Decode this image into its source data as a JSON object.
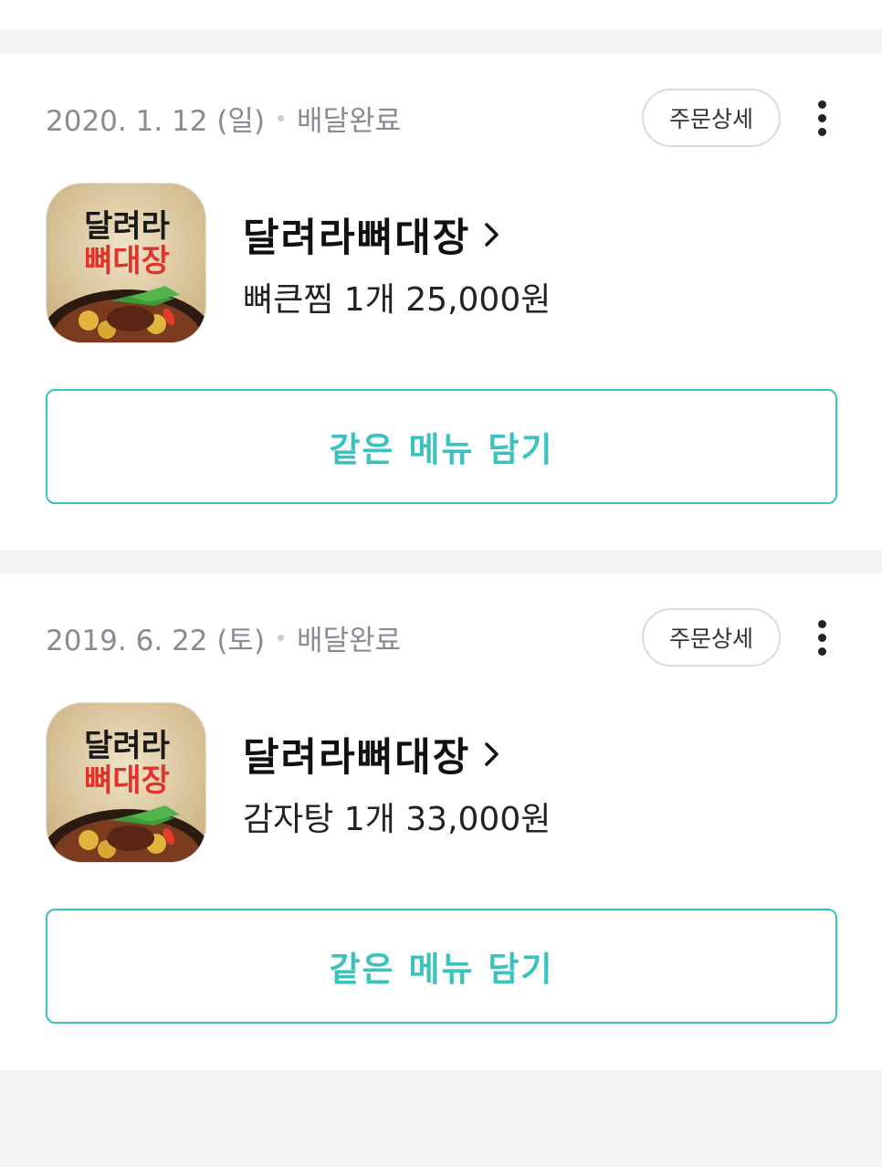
{
  "colors": {
    "accent": "#3bc1be",
    "page_background": "#f2f3f5",
    "card_background": "#ffffff",
    "meta_text": "#888c92"
  },
  "orders": [
    {
      "date": "2020. 1. 12 (일)",
      "status": "배달완료",
      "detail_label": "주문상세",
      "more_icon": "more-vertical-icon",
      "store_name": "달려라뼈대장",
      "logo_line1": "달려라",
      "logo_line2": "뼈대장",
      "menu_summary": "뼈큰찜 1개 25,000원",
      "reorder_label": "같은 메뉴 담기"
    },
    {
      "date": "2019. 6. 22 (토)",
      "status": "배달완료",
      "detail_label": "주문상세",
      "more_icon": "more-vertical-icon",
      "store_name": "달려라뼈대장",
      "logo_line1": "달려라",
      "logo_line2": "뼈대장",
      "menu_summary": "감자탕 1개 33,000원",
      "reorder_label": "같은 메뉴 담기"
    }
  ]
}
